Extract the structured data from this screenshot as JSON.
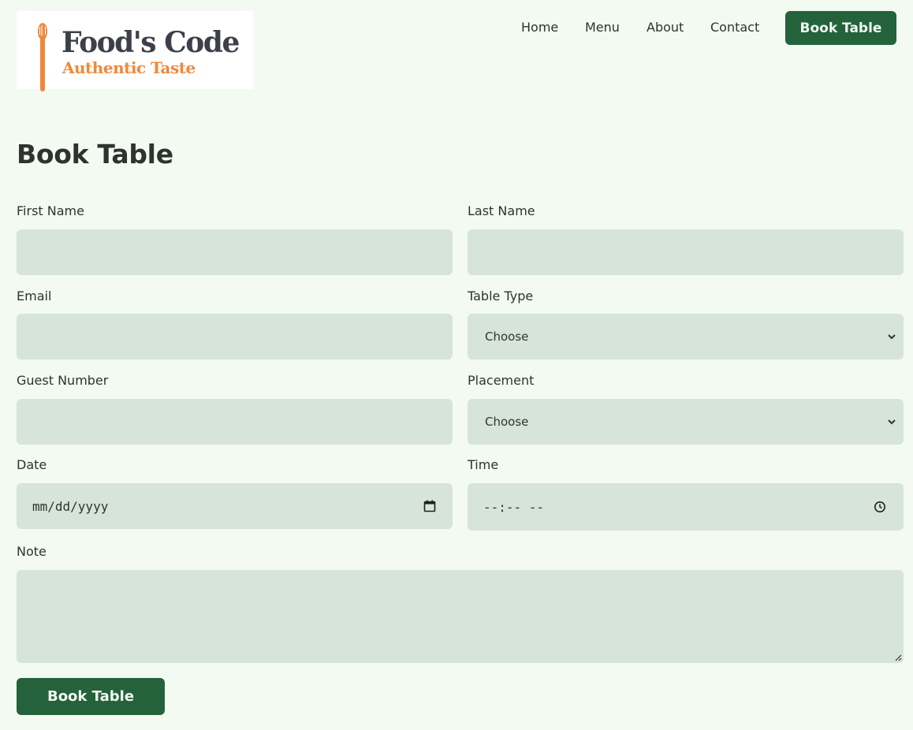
{
  "brand": {
    "name": "Food's Code",
    "tagline": "Authentic Taste",
    "logo_icon": "spoon-icon",
    "accent_color": "#f0883a"
  },
  "nav": {
    "links": [
      "Home",
      "Menu",
      "About",
      "Contact"
    ],
    "cta_label": "Book Table",
    "cta_color": "#24623c"
  },
  "page": {
    "title": "Book Table"
  },
  "form": {
    "first_name": {
      "label": "First Name",
      "value": ""
    },
    "last_name": {
      "label": "Last Name",
      "value": ""
    },
    "email": {
      "label": "Email",
      "value": ""
    },
    "table_type": {
      "label": "Table Type",
      "selected": "Choose",
      "icon": "chevron-down-icon"
    },
    "guest_number": {
      "label": "Guest Number",
      "value": ""
    },
    "placement": {
      "label": "Placement",
      "selected": "Choose",
      "icon": "chevron-down-icon"
    },
    "date": {
      "label": "Date",
      "placeholder": "mm/dd/yyyy",
      "icon": "calendar-icon"
    },
    "time": {
      "label": "Time",
      "placeholder": "--:-- --",
      "icon": "clock-icon"
    },
    "note": {
      "label": "Note",
      "value": ""
    },
    "submit_label": "Book Table",
    "field_color": "#d6e4d9"
  }
}
